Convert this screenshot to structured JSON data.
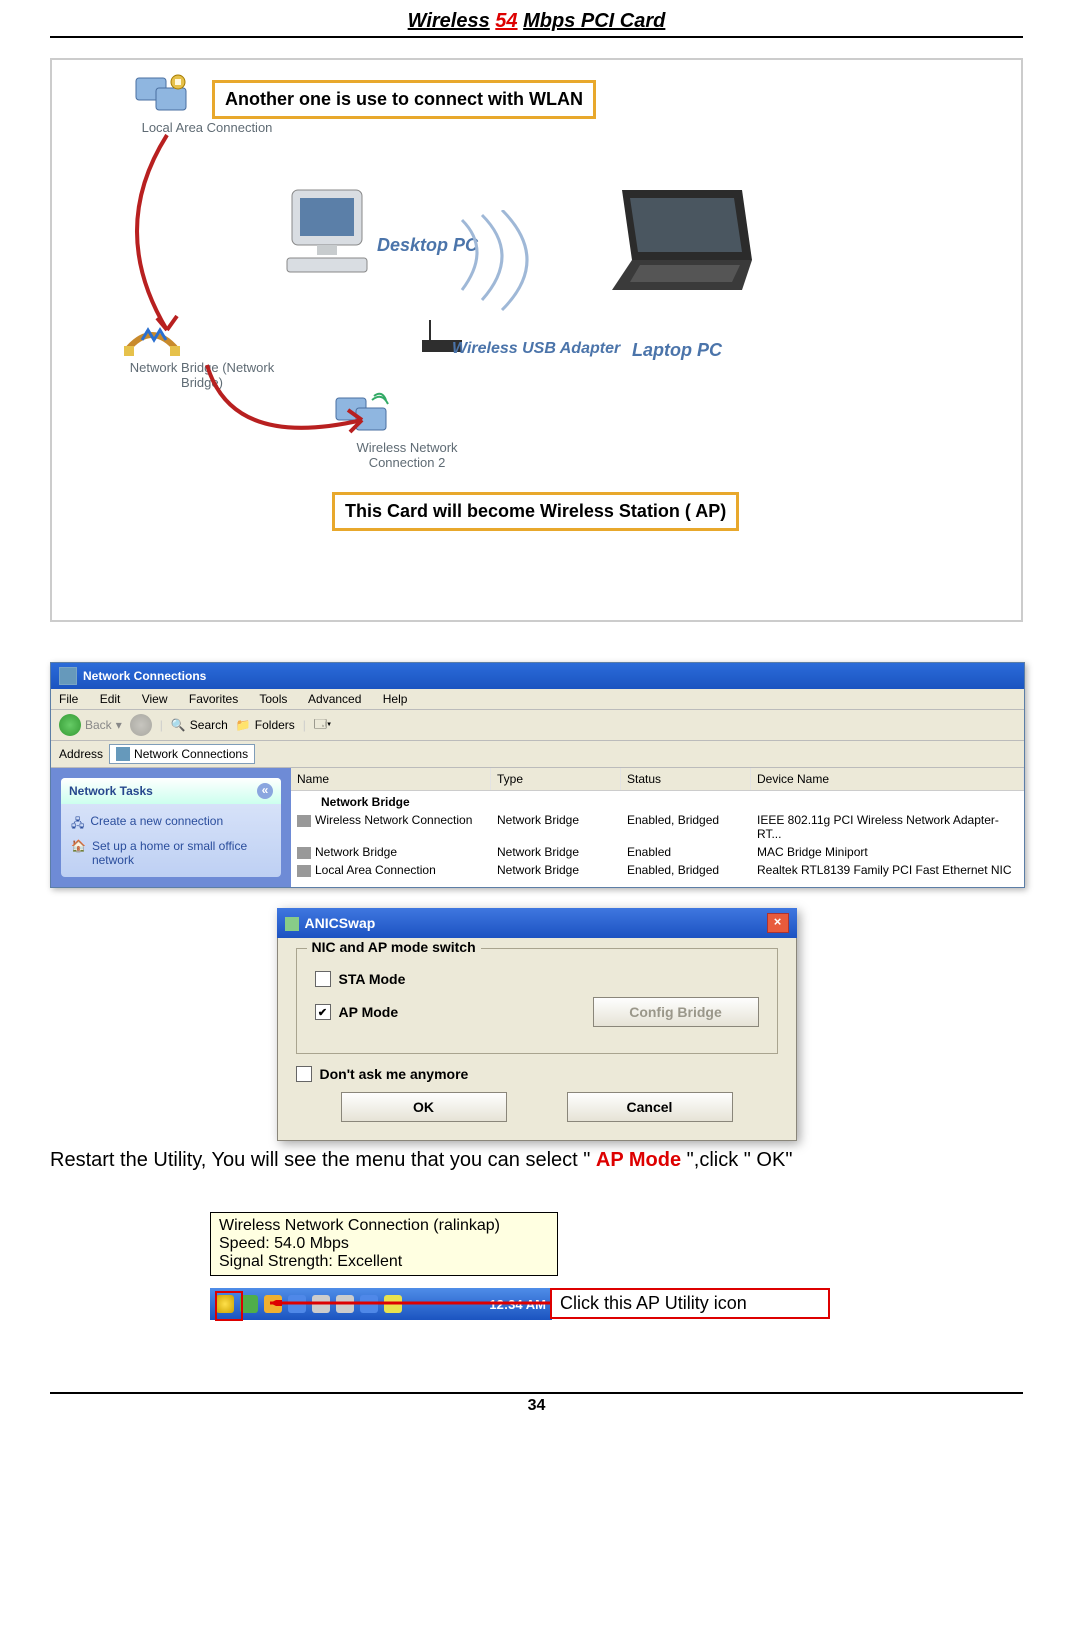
{
  "header": {
    "word1": "Wireless",
    "red": "54",
    "rest": "Mbps PCI Card"
  },
  "diagram": {
    "callout1": "Another  one is use to connect with WLAN",
    "callout2": "This Card  will become Wireless Station ( AP)",
    "local_area_connection": "Local Area Connection",
    "network_bridge": "Network Bridge (Network Bridge)",
    "wireless_network_conn2": "Wireless Network Connection 2",
    "desktop_pc": "Desktop PC",
    "wireless_usb_adapter": "Wireless USB Adapter",
    "laptop_pc": "Laptop PC"
  },
  "netconn": {
    "title": "Network Connections",
    "menu": {
      "file": "File",
      "edit": "Edit",
      "view": "View",
      "favorites": "Favorites",
      "tools": "Tools",
      "advanced": "Advanced",
      "help": "Help"
    },
    "toolbar": {
      "back": "Back",
      "search": "Search",
      "folders": "Folders"
    },
    "address_label": "Address",
    "address_value": "Network Connections",
    "side_head": "Network Tasks",
    "task_create": "Create a new connection",
    "task_setup": "Set up a home or small office network",
    "col_name": "Name",
    "col_type": "Type",
    "col_status": "Status",
    "col_device": "Device Name",
    "group_heading": "Network Bridge",
    "rows": [
      {
        "name": "Wireless Network Connection",
        "type": "Network Bridge",
        "status": "Enabled, Bridged",
        "device": "IEEE 802.11g PCI Wireless Network Adapter-RT..."
      },
      {
        "name": "Network Bridge",
        "type": "Network Bridge",
        "status": "Enabled",
        "device": "MAC Bridge Miniport"
      },
      {
        "name": "Local Area Connection",
        "type": "Network Bridge",
        "status": "Enabled, Bridged",
        "device": "Realtek RTL8139 Family PCI Fast Ethernet NIC"
      }
    ]
  },
  "dialog": {
    "title": "ANICSwap",
    "legend": "NIC and AP mode switch",
    "sta": "STA Mode",
    "ap": "AP Mode",
    "config_bridge": "Config Bridge",
    "dont_ask": "Don't ask me anymore",
    "ok": "OK",
    "cancel": "Cancel",
    "sta_checked": false,
    "ap_checked": true,
    "dont_ask_checked": false
  },
  "instruction": {
    "pre": "Restart the Utility, You will see the menu that you can select  \" ",
    "ap_mode": "AP Mode",
    "post": " \",click  \" OK\""
  },
  "tray": {
    "tooltip_line1": "Wireless Network Connection (ralinkap)",
    "tooltip_line2": "Speed: 54.0 Mbps",
    "tooltip_line3": "Signal Strength: Excellent",
    "clock": "12:34 AM",
    "callout": "Click this AP Utility icon"
  },
  "page_number": "34"
}
